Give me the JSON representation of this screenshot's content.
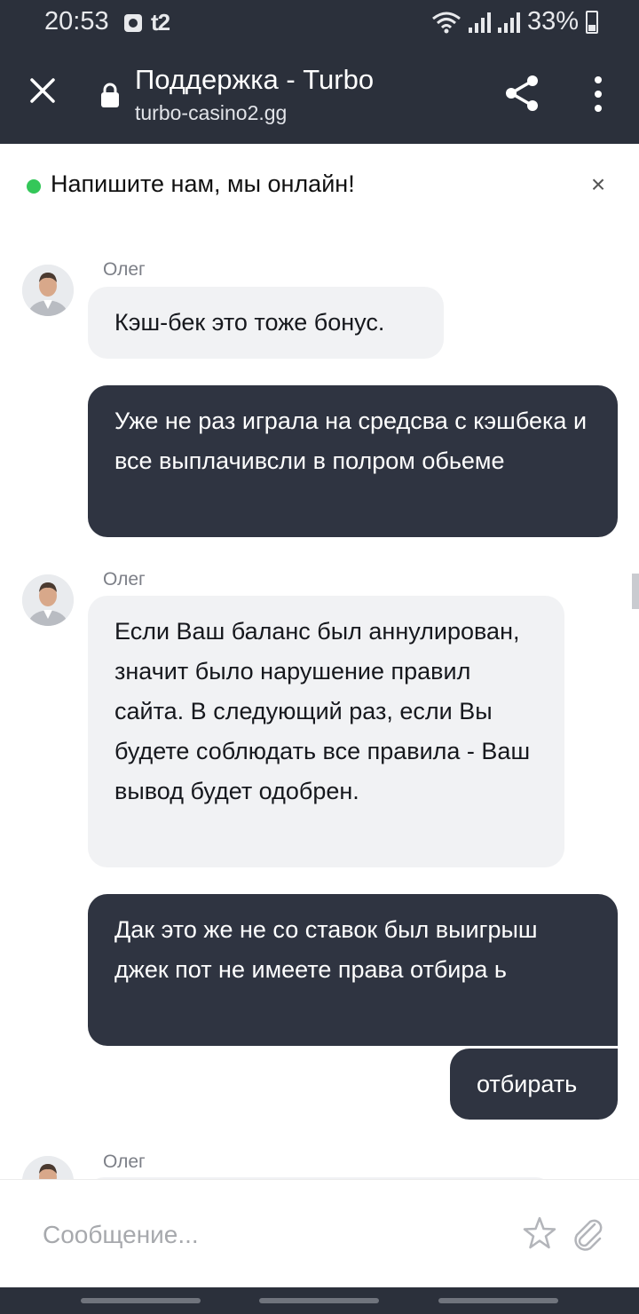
{
  "status_bar": {
    "time": "20:53",
    "carrier": "t2",
    "battery": "33%",
    "icons": [
      "alarm-icon",
      "wifi-icon",
      "signal-icon",
      "signal-icon",
      "battery-icon"
    ]
  },
  "browser": {
    "title": "Поддержка - Turbo",
    "url": "turbo-casino2.gg",
    "icons": [
      "close-icon",
      "lock-icon",
      "share-icon",
      "more-vert-icon"
    ]
  },
  "chat": {
    "banner": "Напишите нам, мы онлайн!",
    "banner_close": "×",
    "messages": [
      {
        "sender": "Олег",
        "text": "Кэш-бек это тоже бонус.",
        "direction": "in"
      },
      {
        "text": "Уже не раз играла на средсва с кэшбека и все выплачивсли в полром обьеме",
        "direction": "out"
      },
      {
        "sender": "Олег",
        "text": "Если Ваш баланс был аннулирован, значит было нарушение правил сайта. В следующий раз, если Вы будете соблюдать все правила - Ваш вывод будет одобрен.",
        "direction": "in"
      },
      {
        "text": "Дак это же не со ставок был выигрыш джек пот не имеете права отбира ь",
        "direction": "out"
      },
      {
        "text": "отбирать",
        "direction": "out"
      },
      {
        "sender": "Олег",
        "text": "",
        "direction": "in"
      }
    ],
    "input_placeholder": "Сообщение...",
    "input_icons": [
      "star-icon",
      "paperclip-icon"
    ]
  },
  "colors": {
    "header_bg": "#2b303b",
    "outgoing_bubble": "#2f3441",
    "incoming_bubble": "#f1f2f4",
    "online": "#34c759"
  }
}
